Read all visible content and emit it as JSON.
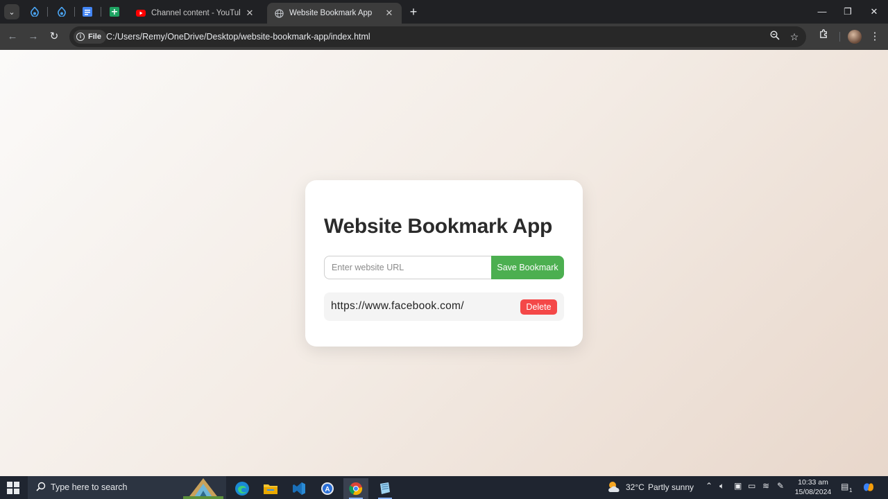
{
  "browser": {
    "tabs": [
      {
        "title": "Channel content - YouTube Stu",
        "icon": "youtube-icon",
        "active": false
      },
      {
        "title": "Website Bookmark App",
        "icon": "globe-icon",
        "active": true
      }
    ],
    "pinned_tabs": [
      "drupal-icon",
      "drupal-icon",
      "docs-icon",
      "sheets-icon"
    ],
    "address": {
      "scheme_chip": "File",
      "url": "C:/Users/Remy/OneDrive/Desktop/website-bookmark-app/index.html"
    },
    "window_controls": {
      "minimize": "—",
      "maximize": "❐",
      "close": "✕"
    }
  },
  "app": {
    "title": "Website Bookmark App",
    "input_placeholder": "Enter website URL",
    "input_value": "",
    "save_label": "Save Bookmark",
    "bookmarks": [
      {
        "url": "https://www.facebook.com/",
        "delete_label": "Delete"
      }
    ],
    "colors": {
      "save_button": "#4caf50",
      "delete_button": "#f44848"
    }
  },
  "taskbar": {
    "search_placeholder": "Type here to search",
    "weather": {
      "temp": "32°C",
      "condition": "Partly sunny"
    },
    "time": "10:33 am",
    "date": "15/08/2024",
    "notification_count": "1",
    "apps": [
      "edge-icon",
      "file-explorer-icon",
      "vscode-icon",
      "app-a-icon",
      "chrome-icon",
      "notepad-icon"
    ]
  }
}
